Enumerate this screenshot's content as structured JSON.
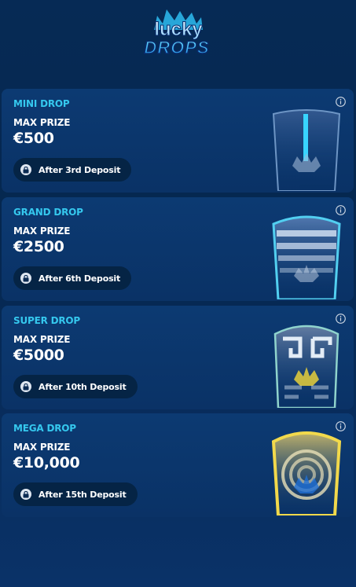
{
  "logo": {
    "top": "lucky",
    "bottom": "DROPS"
  },
  "drops": [
    {
      "tier": "MINI DROP",
      "prize_label": "MAX PRIZE",
      "amount": "€500",
      "unlock": "After 3rd Deposit",
      "badge": "mini-shield"
    },
    {
      "tier": "GRAND DROP",
      "prize_label": "MAX PRIZE",
      "amount": "€2500",
      "unlock": "After 6th Deposit",
      "badge": "grand-shield"
    },
    {
      "tier": "SUPER DROP",
      "prize_label": "MAX PRIZE",
      "amount": "€5000",
      "unlock": "After 10th Deposit",
      "badge": "super-shield"
    },
    {
      "tier": "MEGA DROP",
      "prize_label": "MAX PRIZE",
      "amount": "€10,000",
      "unlock": "After 15th Deposit",
      "badge": "mega-shield"
    }
  ],
  "colors": {
    "accent": "#35c8ee",
    "card": "#0c3a72",
    "pill": "#052445"
  }
}
